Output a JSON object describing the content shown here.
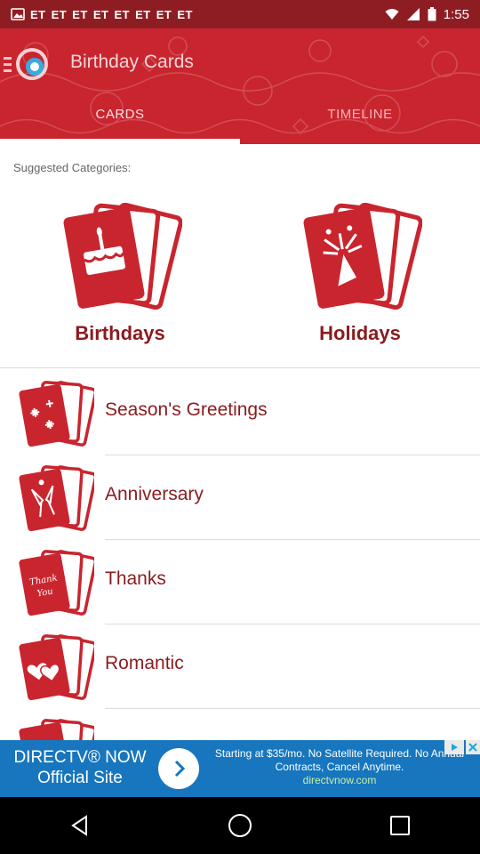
{
  "status_bar": {
    "notification_icons": [
      "ET",
      "ET",
      "ET",
      "ET",
      "ET",
      "ET",
      "ET",
      "ET"
    ],
    "time": "1:55"
  },
  "header": {
    "title": "Birthday Cards",
    "tabs": [
      {
        "label": "CARDS",
        "selected": true
      },
      {
        "label": "TIMELINE",
        "selected": false
      }
    ]
  },
  "content": {
    "suggested_label": "Suggested Categories:",
    "featured": [
      {
        "label": "Birthdays",
        "icon": "birthday-cake-card-icon"
      },
      {
        "label": "Holidays",
        "icon": "party-popper-card-icon"
      }
    ],
    "list": [
      {
        "label": "Season's Greetings",
        "icon": "snowflake-card-icon"
      },
      {
        "label": "Anniversary",
        "icon": "champagne-glasses-card-icon"
      },
      {
        "label": "Thanks",
        "icon": "thank-you-card-icon"
      },
      {
        "label": "Romantic",
        "icon": "hearts-card-icon"
      },
      {
        "label": "",
        "icon": "get-well-card-icon"
      }
    ]
  },
  "ad": {
    "title_line1": "DIRECTV® NOW",
    "title_line2": "Official Site",
    "body": "Starting at $35/mo. No Satellite Required. No Annual Contracts, Cancel Anytime.",
    "url": "directvnow.com"
  },
  "colors": {
    "header": "#c9252f",
    "status_bar": "#8e1d23",
    "accent_text": "#8b1b1f",
    "ad_bg": "#1776bd"
  }
}
